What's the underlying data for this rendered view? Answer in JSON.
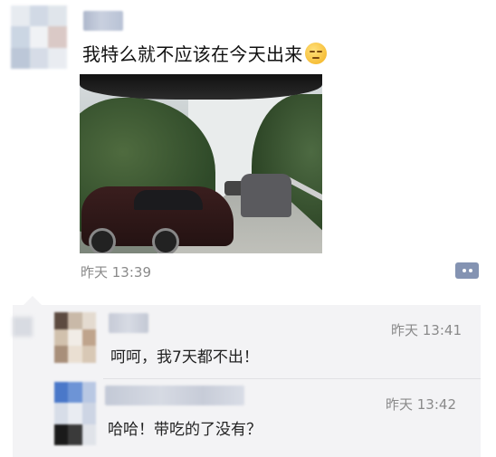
{
  "post": {
    "text": "我特么就不应该在今天出来",
    "emoji": "unamused-face-emoji",
    "timestamp": "昨天 13:39",
    "photo": "traffic-jam-photo"
  },
  "comments": [
    {
      "timestamp": "昨天 13:41",
      "text": "呵呵，我7天都不出！"
    },
    {
      "timestamp": "昨天 13:42",
      "text": "哈哈！带吃的了没有？"
    }
  ],
  "colors": {
    "more_button": "#8493b2",
    "comment_bg": "#f3f3f5",
    "timestamp": "#8a8a8a"
  }
}
